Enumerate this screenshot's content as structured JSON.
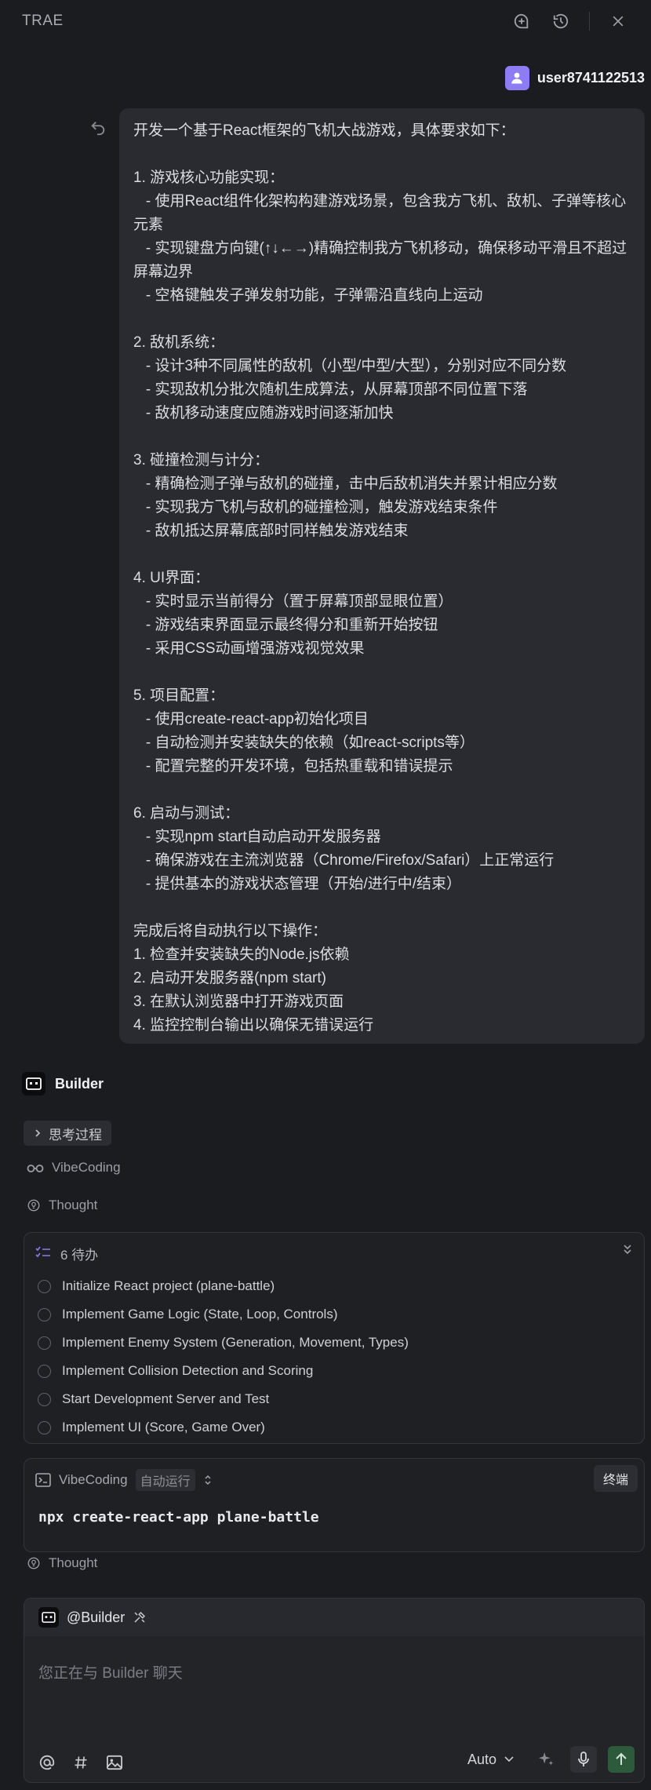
{
  "app": {
    "title": "TRAE"
  },
  "user": {
    "name": "user8741122513"
  },
  "prompt": {
    "text": "开发一个基于React框架的飞机大战游戏，具体要求如下：\n\n1. 游戏核心功能实现：\n   - 使用React组件化架构构建游戏场景，包含我方飞机、敌机、子弹等核心元素\n   - 实现键盘方向键(↑↓←→)精确控制我方飞机移动，确保移动平滑且不超过屏幕边界\n   - 空格键触发子弹发射功能，子弹需沿直线向上运动\n\n2. 敌机系统：\n   - 设计3种不同属性的敌机（小型/中型/大型），分别对应不同分数\n   - 实现敌机分批次随机生成算法，从屏幕顶部不同位置下落\n   - 敌机移动速度应随游戏时间逐渐加快\n\n3. 碰撞检测与计分：\n   - 精确检测子弹与敌机的碰撞，击中后敌机消失并累计相应分数\n   - 实现我方飞机与敌机的碰撞检测，触发游戏结束条件\n   - 敌机抵达屏幕底部时同样触发游戏结束\n\n4. UI界面：\n   - 实时显示当前得分（置于屏幕顶部显眼位置）\n   - 游戏结束界面显示最终得分和重新开始按钮\n   - 采用CSS动画增强游戏视觉效果\n\n5. 项目配置：\n   - 使用create-react-app初始化项目\n   - 自动检测并安装缺失的依赖（如react-scripts等）\n   - 配置完整的开发环境，包括热重载和错误提示\n\n6. 启动与测试：\n   - 实现npm start自动启动开发服务器\n   - 确保游戏在主流浏览器（Chrome/Firefox/Safari）上正常运行\n   - 提供基本的游戏状态管理（开始/进行中/结束）\n\n完成后将自动执行以下操作：\n1. 检查并安装缺失的Node.js依赖\n2. 启动开发服务器(npm start)\n3. 在默认浏览器中打开游戏页面\n4. 监控控制台输出以确保无错误运行"
  },
  "agent": {
    "name": "Builder"
  },
  "thinking_chip": {
    "label": "思考过程"
  },
  "vibecoding_label": "VibeCoding",
  "thought_1": "Thought",
  "todo": {
    "header": "6 待办",
    "items": [
      {
        "label": "Initialize React project (plane-battle)"
      },
      {
        "label": "Implement Game Logic (State, Loop, Controls)"
      },
      {
        "label": "Implement Enemy System (Generation, Movement, Types)"
      },
      {
        "label": "Implement Collision Detection and Scoring"
      },
      {
        "label": "Start Development Server and Test"
      },
      {
        "label": "Implement UI (Score, Game Over)"
      }
    ]
  },
  "command": {
    "source": "VibeCoding",
    "mode": "自动运行",
    "terminal_label": "终端",
    "text": "npx create-react-app plane-battle"
  },
  "thought_2": "Thought",
  "composer": {
    "mention": "@Builder",
    "placeholder": "您正在与 Builder 聊天",
    "model": "Auto"
  },
  "icons": {
    "new_chat": "new-chat-icon",
    "history": "history-icon",
    "close": "close-icon",
    "undo": "undo-icon",
    "glasses": "glasses-icon",
    "thought": "lightbulb-icon",
    "todo": "checklist-icon",
    "terminal": "terminal-icon",
    "at": "at-icon",
    "hash": "hash-icon",
    "image": "image-icon",
    "sparkle": "sparkle-icon",
    "mic": "mic-icon",
    "send": "send-icon"
  },
  "colors": {
    "background": "#1b1c20",
    "avatar": "#8d7cf3",
    "send": "#2d5a3b"
  }
}
